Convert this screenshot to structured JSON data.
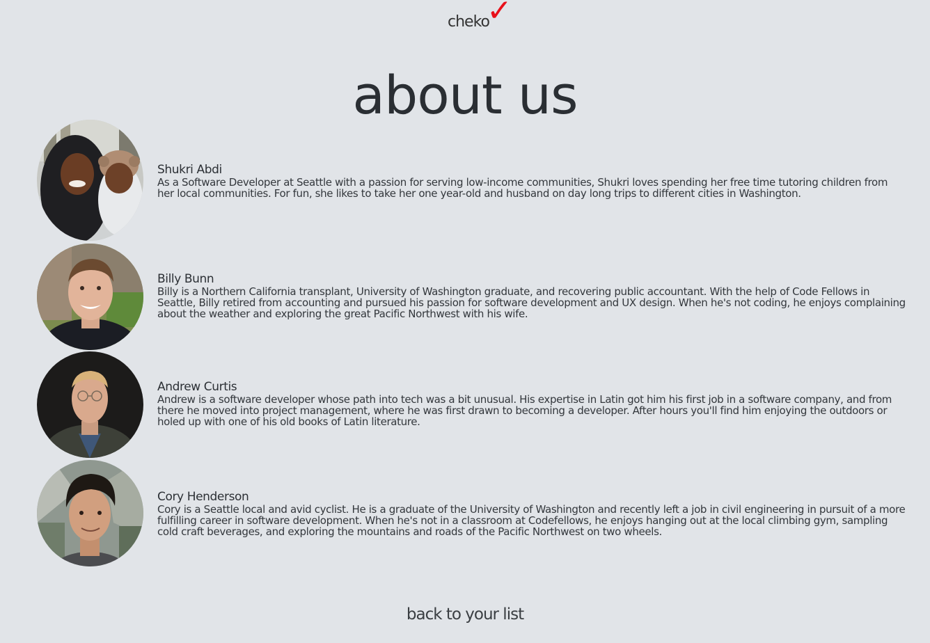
{
  "brand": {
    "logo_text": "cheko",
    "logo_mark": "✓",
    "logo_mark_color": "#e8101a"
  },
  "page": {
    "title": "about us",
    "background_color": "#e1e4e8"
  },
  "team": [
    {
      "name": "Shukri Abdi",
      "bio": "As a Software Developer at Seattle with a passion for serving low-income communities, Shukri loves spending her free time tutoring children from her local communities. For fun, she likes to take her one year-old and husband on day long trips to different cities in Washington.",
      "photo": "woman-in-hijab-with-baby-photo"
    },
    {
      "name": "Billy Bunn",
      "bio": "Billy is a Northern California transplant, University of Washington graduate, and recovering public accountant. With the help of Code Fellows in Seattle, Billy retired from accounting and pursued his passion for software development and UX design. When he's not coding, he enjoys complaining about the weather and exploring the great Pacific Northwest with his wife.",
      "photo": "smiling-man-outdoors-photo"
    },
    {
      "name": "Andrew Curtis",
      "bio": "Andrew is a software developer whose path into tech was a bit unusual. His expertise in Latin got him his first job in a software company, and from there he moved into project management, where he was first drawn to becoming a developer. After hours you'll find him enjoying the outdoors or holed up with one of his old books of Latin literature.",
      "photo": "man-with-glasses-dark-background-photo"
    },
    {
      "name": "Cory Henderson",
      "bio": "Cory is a Seattle local and avid cyclist. He is a graduate of the University of Washington and recently left a job in civil engineering in pursuit of a more fulfilling career in software development. When he's not in a classroom at Codefellows, he enjoys hanging out at the local climbing gym, sampling cold craft beverages, and exploring the mountains and roads of the Pacific Northwest on two wheels.",
      "photo": "man-in-mountains-photo"
    }
  ],
  "footer": {
    "back_link": "back to your list"
  }
}
